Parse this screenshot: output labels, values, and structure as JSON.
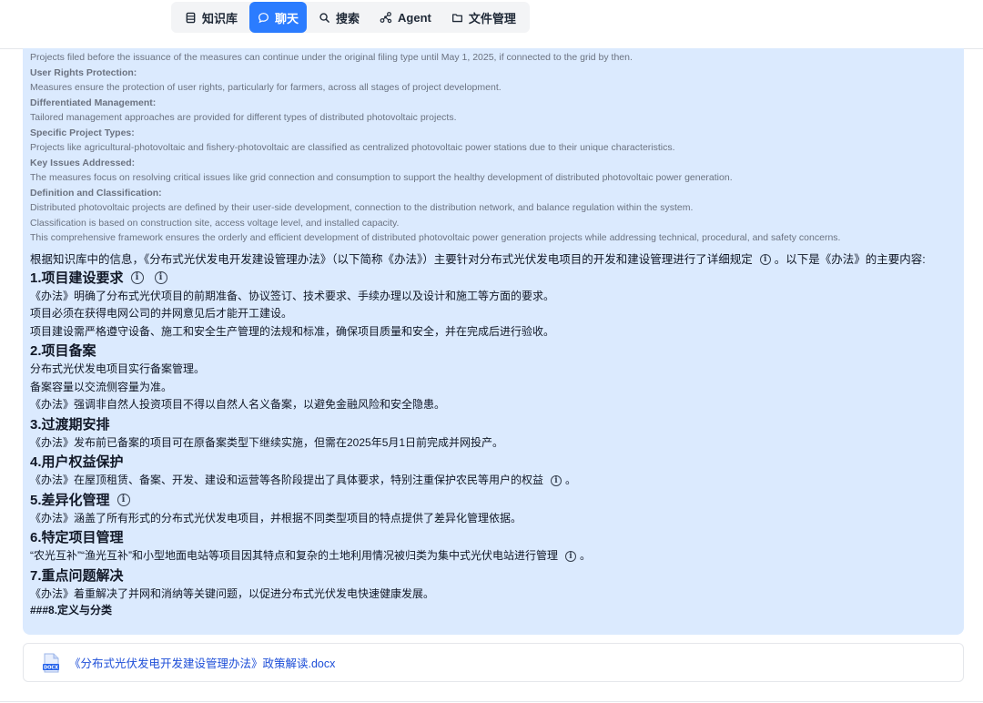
{
  "nav": {
    "items": [
      {
        "label": "知识库",
        "icon": "database-icon",
        "active": false
      },
      {
        "label": "聊天",
        "icon": "chat-bubble-icon",
        "active": true
      },
      {
        "label": "搜索",
        "icon": "search-icon",
        "active": false
      },
      {
        "label": "Agent",
        "icon": "agent-network-icon",
        "active": false
      },
      {
        "label": "文件管理",
        "icon": "folder-icon",
        "active": false
      }
    ],
    "active_color": "#2b7cff"
  },
  "source_text": {
    "lines": [
      {
        "kind": "text",
        "text": "Projects filed before the issuance of the measures can continue under the original filing type until May 1, 2025, if connected to the grid by then."
      },
      {
        "kind": "heading",
        "text": "User Rights Protection:"
      },
      {
        "kind": "text",
        "text": "Measures ensure the protection of user rights, particularly for farmers, across all stages of project development."
      },
      {
        "kind": "heading",
        "text": "Differentiated Management:"
      },
      {
        "kind": "text",
        "text": "Tailored management approaches are provided for different types of distributed photovoltaic projects."
      },
      {
        "kind": "heading",
        "text": "Specific Project Types:"
      },
      {
        "kind": "text",
        "text": "Projects like agricultural-photovoltaic and fishery-photovoltaic are classified as centralized photovoltaic power stations due to their unique characteristics."
      },
      {
        "kind": "heading",
        "text": "Key Issues Addressed:"
      },
      {
        "kind": "text",
        "text": "The measures focus on resolving critical issues like grid connection and consumption to support the healthy development of distributed photovoltaic power generation."
      },
      {
        "kind": "heading",
        "text": "Definition and Classification:"
      },
      {
        "kind": "text",
        "text": "Distributed photovoltaic projects are defined by their user-side development, connection to the distribution network, and balance regulation within the system."
      },
      {
        "kind": "text",
        "text": "Classification is based on construction site, access voltage level, and installed capacity."
      },
      {
        "kind": "text",
        "text": "This comprehensive framework ensures the orderly and efficient development of distributed photovoltaic power generation projects while addressing technical, procedural, and safety concerns."
      }
    ]
  },
  "answer": {
    "intro": "根据知识库中的信息，《分布式光伏发电开发建设管理办法》（以下简称《办法》）主要针对分布式光伏发电项目的开发和建设管理进行了详细规定",
    "intro_tail": "。以下是《办法》的主要内容:",
    "sections": [
      {
        "title": "1.项目建设要求",
        "paras": [
          "《办法》明确了分布式光伏项目的前期准备、协议签订、技术要求、手续办理以及设计和施工等方面的要求。",
          "项目必须在获得电网公司的并网意见后才能开工建设。",
          "项目建设需严格遵守设备、施工和安全生产管理的法规和标准，确保项目质量和安全，并在完成后进行验收。"
        ]
      },
      {
        "title": "2.项目备案",
        "paras": [
          "分布式光伏发电项目实行备案管理。",
          "备案容量以交流侧容量为准。",
          "《办法》强调非自然人投资项目不得以自然人名义备案，以避免金融风险和安全隐患。"
        ]
      },
      {
        "title": "3.过渡期安排",
        "paras": [
          "《办法》发布前已备案的项目可在原备案类型下继续实施，但需在2025年5月1日前完成并网投产。"
        ]
      },
      {
        "title": "4.用户权益保护",
        "paras": [
          "《办法》在屋顶租赁、备案、开发、建设和运营等各阶段提出了具体要求，特别注重保护农民等用户的权益"
        ]
      },
      {
        "title": "5.差异化管理",
        "paras": [
          "《办法》涵盖了所有形式的分布式光伏发电项目，并根据不同类型项目的特点提供了差异化管理依据。"
        ]
      },
      {
        "title": "6.特定项目管理",
        "paras": [
          "“农光互补”“渔光互补”和小型地面电站等项目因其特点和复杂的土地利用情况被归类为集中式光伏电站进行管理"
        ]
      },
      {
        "title": "7.重点问题解决",
        "paras": [
          "《办法》着重解决了并网和消纳等关键问题，以促进分布式光伏发电快速健康发展。"
        ]
      }
    ],
    "tail": "###8.定义与分类",
    "period": "。",
    "info_glyph": "i"
  },
  "file": {
    "name": "《分布式光伏发电开发建设管理办法》政策解读.docx",
    "icon": "docx-file-icon",
    "icon_label": "DOCX"
  }
}
